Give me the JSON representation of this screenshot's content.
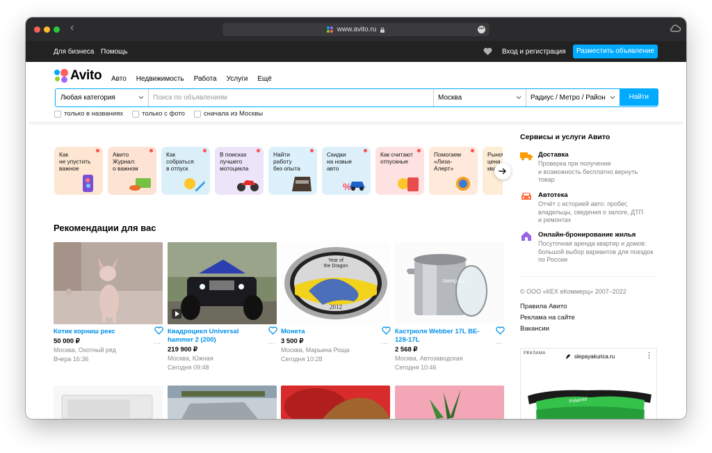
{
  "browser": {
    "url": "www.avito.ru",
    "back_label": "‹"
  },
  "topbar": {
    "business": "Для бизнеса",
    "help": "Помощь",
    "login": "Вход и регистрация",
    "post_ad": "Разместить объявление"
  },
  "header": {
    "logo": "Avito",
    "nav": [
      "Авто",
      "Недвижимость",
      "Работа",
      "Услуги",
      "Ещё"
    ]
  },
  "search": {
    "category": "Любая категория",
    "placeholder": "Поиск по объявлениям",
    "city": "Москва",
    "radius": "Радиус / Метро / Район",
    "button": "Найти"
  },
  "filters": [
    "только в названиях",
    "только с фото",
    "сначала из Москвы"
  ],
  "stories": [
    {
      "text": "Как\nне упустить\nважное",
      "bg": "#fde7d2"
    },
    {
      "text": "Авито\nЖурнал:\nо важном",
      "bg": "#fde3d3"
    },
    {
      "text": "Как\nсобраться\nв отпуск",
      "bg": "#dbeff9"
    },
    {
      "text": "В поисках\nлучшего\nмотоцикла",
      "bg": "#ece5f9"
    },
    {
      "text": "Найти\nработу\nбез опыта",
      "bg": "#dcf1fb"
    },
    {
      "text": "Скидки\nна новые\nавто",
      "bg": "#ddf0fa"
    },
    {
      "text": "Как считают\nотпускные",
      "bg": "#fde2e1"
    },
    {
      "text": "Помогаем\n«Лиза-\nАлерт»",
      "bg": "#fee9da"
    },
    {
      "text": "Рыночная\nцена\nквартиры",
      "bg": "#fdecd6"
    }
  ],
  "recommendations": {
    "title": "Рекомендации для вас",
    "items": [
      {
        "title": "Котик корниш рекс",
        "price": "50 000 ₽",
        "location": "Москва, Охотный ряд",
        "date": "Вчера 16:36"
      },
      {
        "title": "Квадроцикл Universal hammer 2 (200)",
        "price": "219 900 ₽",
        "location": "Москва, Южная",
        "date": "Сегодня 09:48"
      },
      {
        "title": "Монета",
        "price": "3 500 ₽",
        "location": "Москва, Марьина Роща",
        "date": "Сегодня 10:28"
      },
      {
        "title": "Кастрюля Webber 17L BE-128-17L",
        "price": "2 568 ₽",
        "location": "Москва, Автозаводская",
        "date": "Сегодня 10:46"
      }
    ],
    "coin_text": [
      "Year of",
      "the Dragon",
      "2012"
    ],
    "pot_watermark": "пикер.ру"
  },
  "sidebar": {
    "title": "Сервисы и услуги Авито",
    "services": [
      {
        "name": "Доставка",
        "desc": "Проверка при получении\nи возможность бесплатно вернуть\nтовар",
        "icon_color": "#ff9a00"
      },
      {
        "name": "Автотека",
        "desc": "Отчёт с историей авто: пробег,\nвладельцы, сведения о залоге, ДТП\nи ремонтах",
        "icon_color": "#ff6b3d"
      },
      {
        "name": "Онлайн-бронирование жилья",
        "desc": "Посуточная аренда квартир и домов:\nбольшой выбор вариантов для поездок\nпо России",
        "icon_color": "#9863e8"
      }
    ],
    "copyright": "© ООО «КЕХ еКоммерц» 2007–2022",
    "links": [
      "Правила Авито",
      "Реклама на сайте",
      "Вакансии"
    ],
    "ad": {
      "label": "РЕКЛАМА",
      "site": "slepayakurica.ru",
      "menu": "⋮",
      "brand": "Polaroid"
    }
  },
  "colors": {
    "accent": "#00aaff",
    "link": "#0091ea",
    "topbar": "#222222"
  },
  "icons": {
    "story_next": "arrow-right-icon",
    "favorite": "heart-icon",
    "more": "more-dots-icon"
  }
}
